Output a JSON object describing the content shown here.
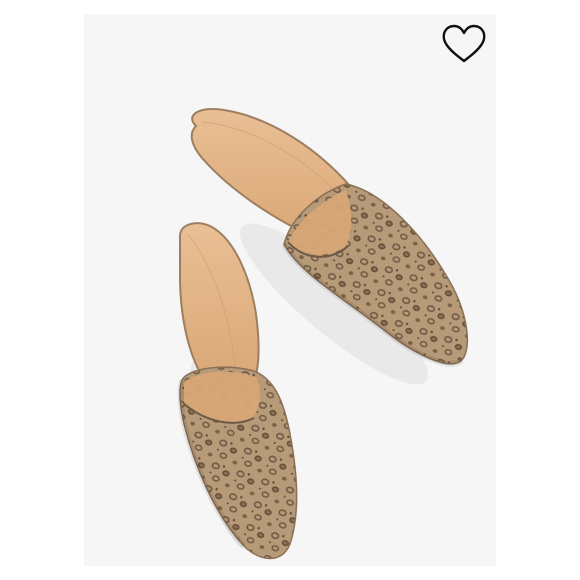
{
  "product_image": {
    "subject": "leopard-print-pointed-mules",
    "background_color": "#f6f6f7",
    "upper_color": "#b79a77",
    "insole_color": "#e4b58a",
    "spot_color": "#6e5a45"
  },
  "favorite": {
    "icon": "heart-outline-icon",
    "selected": false
  }
}
